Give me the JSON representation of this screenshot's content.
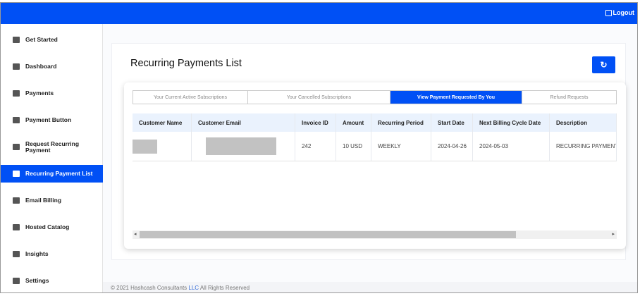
{
  "header": {
    "logout_label": "Logout"
  },
  "sidebar": {
    "items": [
      {
        "label": "Get Started",
        "icon": "briefcase-icon"
      },
      {
        "label": "Dashboard",
        "icon": "dashboard-icon"
      },
      {
        "label": "Payments",
        "icon": "dollar-circle-icon"
      },
      {
        "label": "Payment Button",
        "icon": "bank-icon"
      },
      {
        "label": "Request Recurring Payment",
        "icon": "card-add-icon"
      },
      {
        "label": "Recurring Payment List",
        "icon": "list-icon",
        "active": true
      },
      {
        "label": "Email Billing",
        "icon": "document-icon"
      },
      {
        "label": "Hosted Catalog",
        "icon": "book-icon"
      },
      {
        "label": "Insights",
        "icon": "chart-icon"
      },
      {
        "label": "Settings",
        "icon": "gear-icon"
      }
    ]
  },
  "main": {
    "title": "Recurring Payments List",
    "refresh_icon": "refresh-icon",
    "tabs": [
      {
        "label": "Your Current Active Subscriptions"
      },
      {
        "label": "Your Cancelled Subscriptions"
      },
      {
        "label": "View Payment Requested By You",
        "active": true
      },
      {
        "label": "Refund Requests"
      }
    ],
    "table": {
      "columns": [
        "Customer Name",
        "Customer Email",
        "Invoice ID",
        "Amount",
        "Recurring Period",
        "Start Date",
        "Next Billing Cycle Date",
        "Description"
      ],
      "rows": [
        [
          "",
          "",
          "242",
          "10 USD",
          "WEEKLY",
          "2024-04-26",
          "2024-05-03",
          "RECURRING PAYMENT"
        ]
      ]
    }
  },
  "footer": {
    "prefix": "© 2021 Hashcash Consultants ",
    "company": "LLC",
    "suffix": " All Rights Reserved"
  },
  "colors": {
    "accent": "#0050f5"
  }
}
